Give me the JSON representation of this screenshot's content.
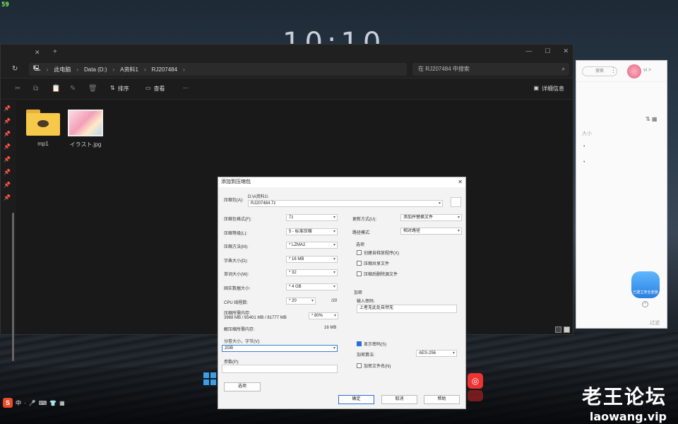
{
  "fps": "59",
  "clock": "10:10",
  "explorer": {
    "breadcrumb": [
      "此电脑",
      "Data (D:)",
      "A资料1",
      "RJ207484"
    ],
    "search_placeholder": "在 RJ207484 中搜索",
    "toolbar": {
      "sort_label": "排序",
      "view_label": "查看",
      "more_label": "···",
      "details_label": "详细信息"
    },
    "files": [
      {
        "name": "mp1",
        "type": "folder"
      },
      {
        "name": "イラスト.jpg",
        "type": "image"
      }
    ]
  },
  "right_window": {
    "search_btn": "搜索",
    "vip": "vi >",
    "label": "大小",
    "cloud_text": "已建立安全连接",
    "footer": "过滤"
  },
  "dialog": {
    "title": "添加到压缩包",
    "archive_name_label": "压缩包(A):",
    "archive_path": "D:\\A资料1\\",
    "archive_name_value": "RJ207484.7z",
    "format_label": "压缩包格式(F):",
    "format_value": "7z",
    "level_label": "压缩等级(L):",
    "level_value": "5 - 标准压缩",
    "method_label": "压缩方法(M):",
    "method_value": "* LZMA2",
    "dict_label": "字典大小(D):",
    "dict_value": "* 16 MB",
    "word_label": "单词大小(W):",
    "word_value": "* 32",
    "solid_label": "固实数据大小:",
    "solid_value": "* 4 GB",
    "threads_label": "CPU 线程数:",
    "threads_value": "* 20",
    "threads_max": "/20",
    "mem_label": "压缩所需内存:",
    "mem_detail": "3968 MB / 65401 MB / 81777 MB",
    "mem_value": "* 80%",
    "decomp_label": "解压缩所需内存:",
    "decomp_value": "16 MB",
    "split_label": "分卷大小，字节(V):",
    "split_value": "2GB",
    "params_label": "参数(P):",
    "params_value": "",
    "options_button": "选项",
    "update_mode_label": "更新方式(U):",
    "update_mode_value": "添加并替换文件",
    "path_mode_label": "路径模式:",
    "path_mode_value": "相对路径",
    "options_title": "选项",
    "opt_sfx": "创建自释放程序(X)",
    "opt_shared": "压缩共享文件",
    "opt_delete": "压缩后删除源文件",
    "encrypt_title": "加密",
    "encrypt_label": "输入密码:",
    "encrypt_value": "上者无此处自然无",
    "show_password": "显示密码(S)",
    "encrypt_method_label": "加密算法:",
    "encrypt_method_value": "AES-256",
    "encrypt_names": "加密文件名(N)",
    "ok": "确定",
    "cancel": "取消",
    "help": "帮助"
  },
  "watermark": {
    "title": "老王论坛",
    "url": "laowang.vip"
  }
}
